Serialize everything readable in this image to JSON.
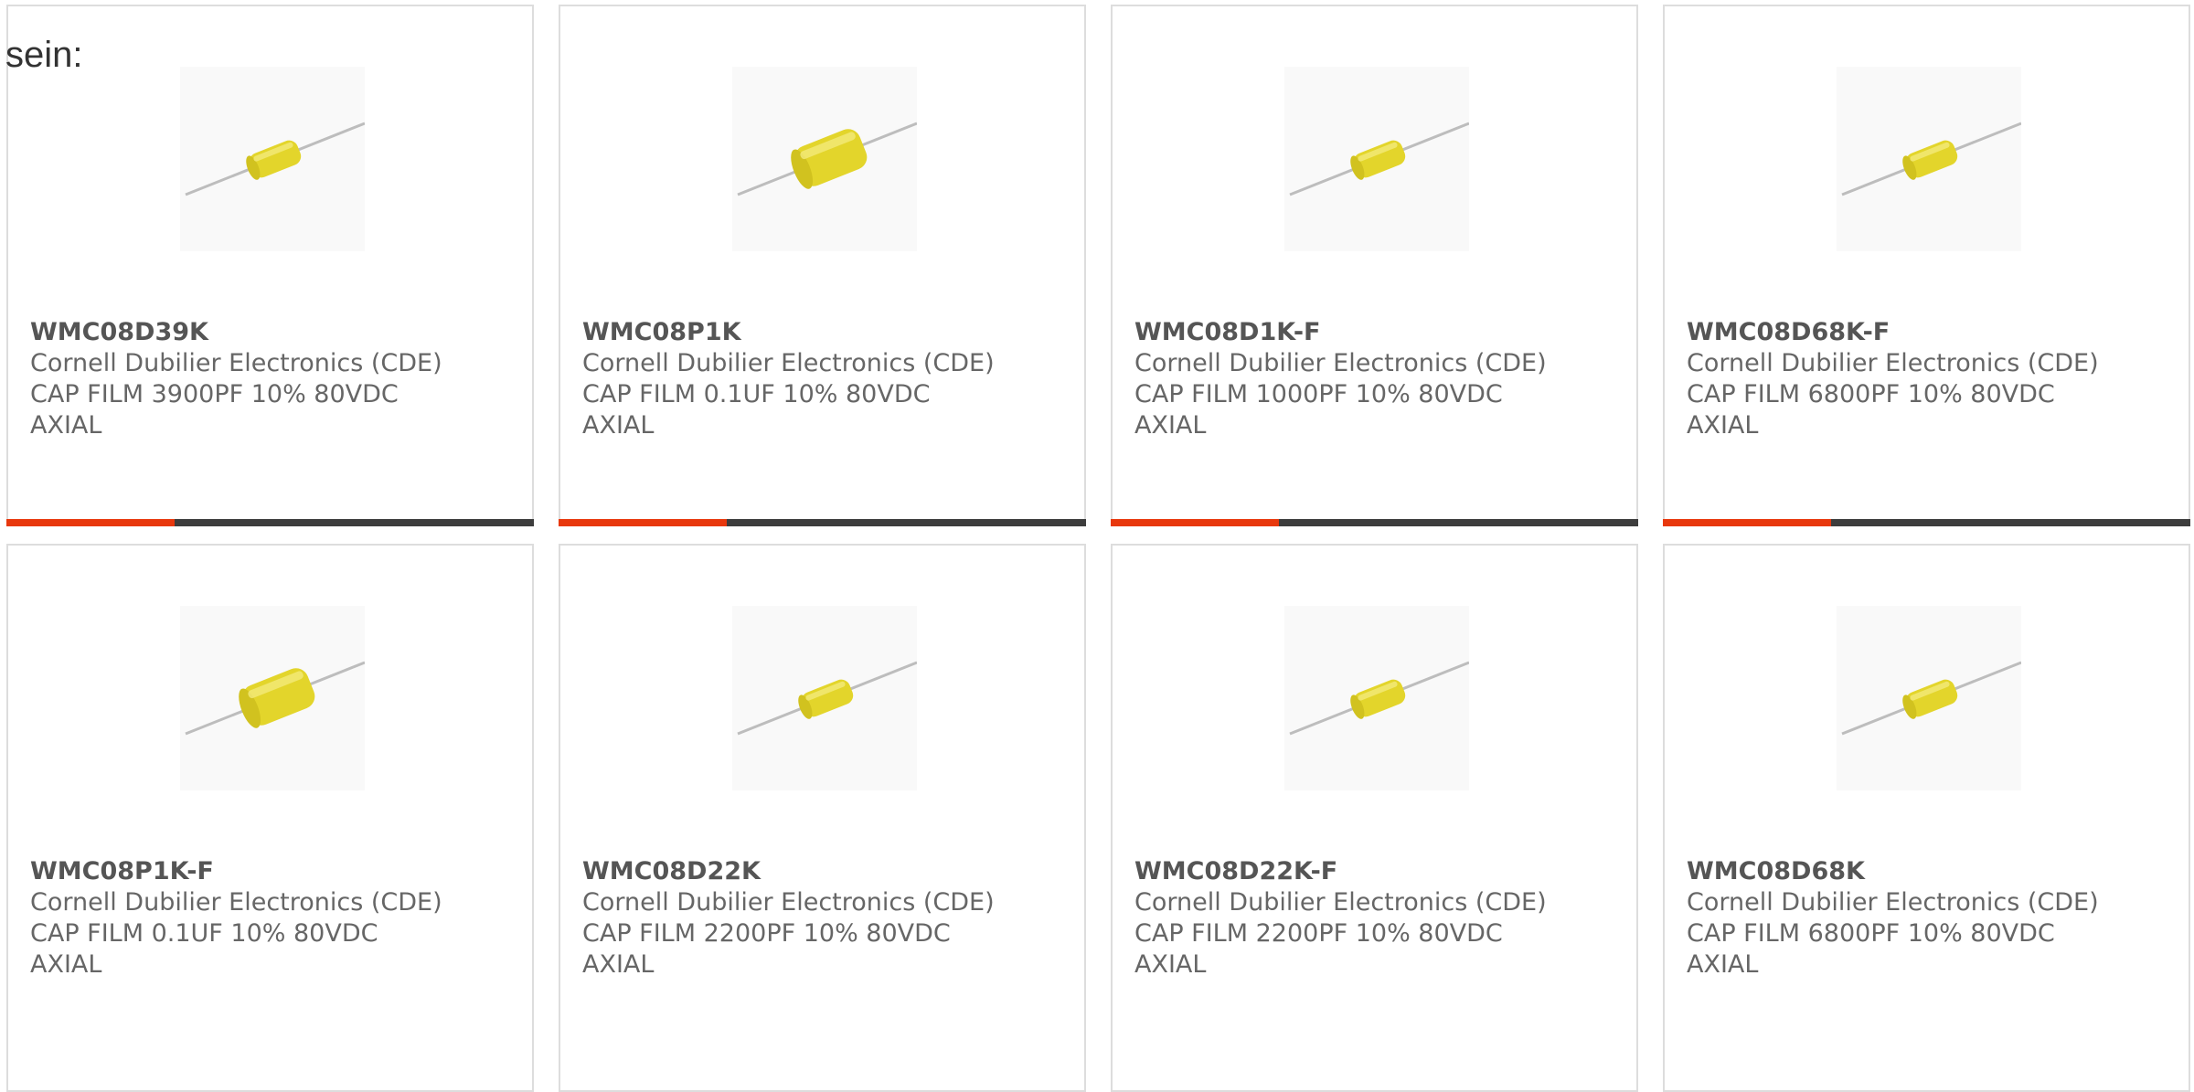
{
  "intro_text": "sein:",
  "colors": {
    "accent": "#e8380d",
    "bar_dark": "#3d3d3d",
    "capacitor_body": "#e8d92a",
    "lead_wire": "#b8b8b8"
  },
  "products": [
    {
      "part_number": "WMC08D39K",
      "manufacturer": "Cornell Dubilier Electronics (CDE)",
      "desc_line1": "CAP FILM 3900PF 10% 80VDC",
      "desc_line2": "AXIAL",
      "image": "axial-film-capacitor-small-icon"
    },
    {
      "part_number": "WMC08P1K",
      "manufacturer": "Cornell Dubilier Electronics (CDE)",
      "desc_line1": "CAP FILM 0.1UF 10% 80VDC",
      "desc_line2": "AXIAL",
      "image": "axial-film-capacitor-large-icon"
    },
    {
      "part_number": "WMC08D1K-F",
      "manufacturer": "Cornell Dubilier Electronics (CDE)",
      "desc_line1": "CAP FILM 1000PF 10% 80VDC",
      "desc_line2": "AXIAL",
      "image": "axial-film-capacitor-small-icon"
    },
    {
      "part_number": "WMC08D68K-F",
      "manufacturer": "Cornell Dubilier Electronics (CDE)",
      "desc_line1": "CAP FILM 6800PF 10% 80VDC",
      "desc_line2": "AXIAL",
      "image": "axial-film-capacitor-small-icon"
    },
    {
      "part_number": "WMC08P1K-F",
      "manufacturer": "Cornell Dubilier Electronics (CDE)",
      "desc_line1": "CAP FILM 0.1UF 10% 80VDC",
      "desc_line2": "AXIAL",
      "image": "axial-film-capacitor-large-icon"
    },
    {
      "part_number": "WMC08D22K",
      "manufacturer": "Cornell Dubilier Electronics (CDE)",
      "desc_line1": "CAP FILM 2200PF 10% 80VDC",
      "desc_line2": "AXIAL",
      "image": "axial-film-capacitor-small-icon"
    },
    {
      "part_number": "WMC08D22K-F",
      "manufacturer": "Cornell Dubilier Electronics (CDE)",
      "desc_line1": "CAP FILM 2200PF 10% 80VDC",
      "desc_line2": "AXIAL",
      "image": "axial-film-capacitor-small-icon"
    },
    {
      "part_number": "WMC08D68K",
      "manufacturer": "Cornell Dubilier Electronics (CDE)",
      "desc_line1": "CAP FILM 6800PF 10% 80VDC",
      "desc_line2": "AXIAL",
      "image": "axial-film-capacitor-small-icon"
    }
  ]
}
